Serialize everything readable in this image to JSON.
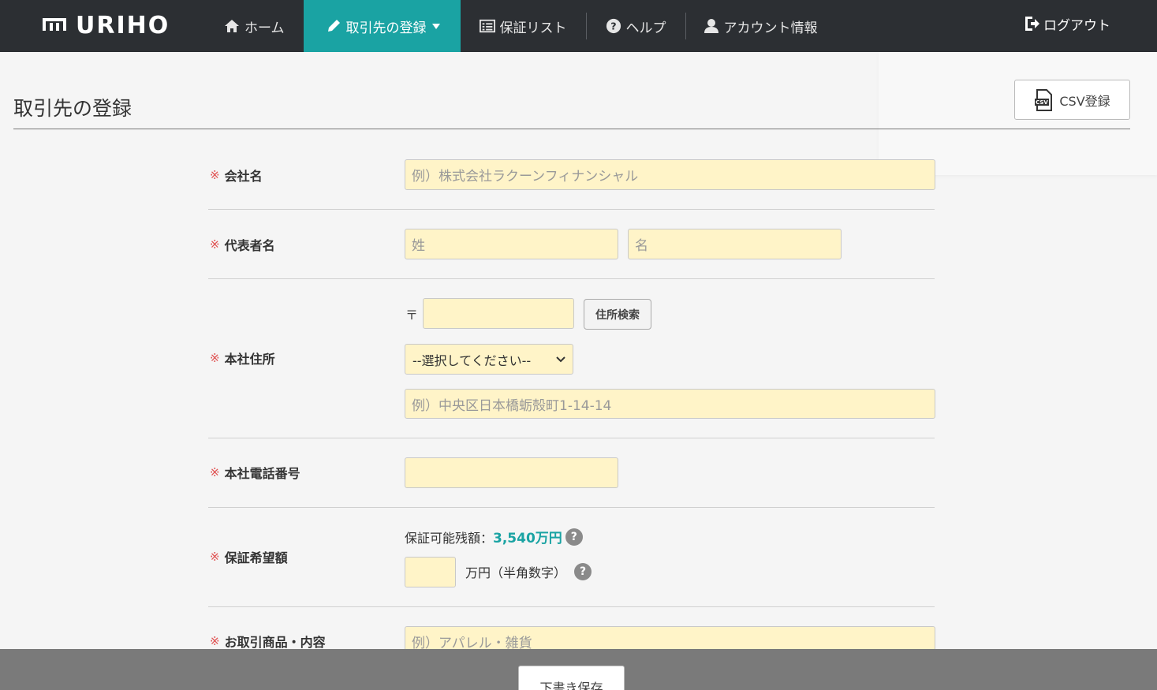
{
  "header": {
    "logo": "URIHO",
    "nav": [
      {
        "label": "ホーム"
      },
      {
        "label": "取引先の登録"
      },
      {
        "label": "保証リスト"
      },
      {
        "label": "ヘルプ"
      },
      {
        "label": "アカウント情報"
      }
    ],
    "logout": "ログアウト"
  },
  "page": {
    "title": "取引先の登録",
    "csv_button": "CSV登録"
  },
  "form": {
    "required_mark": "※",
    "company": {
      "label": "会社名",
      "placeholder": "例）株式会社ラクーンフィナンシャル"
    },
    "representative": {
      "label": "代表者名",
      "last_placeholder": "姓",
      "first_placeholder": "名"
    },
    "address": {
      "label": "本社住所",
      "postal_mark": "〒",
      "search_button": "住所検索",
      "prefecture_selected": "--選択してください--",
      "street_placeholder": "例）中央区日本橋蛎殻町1-14-14"
    },
    "phone": {
      "label": "本社電話番号"
    },
    "amount": {
      "label": "保証希望額",
      "available_label": "保証可能残額：",
      "available_value": "3,540万円",
      "help": "?",
      "unit": "万円（半角数字）"
    },
    "products": {
      "label": "お取引商品・内容",
      "placeholder": "例）アパレル・雑貨"
    }
  },
  "footer": {
    "draft_button": "下書き保存"
  }
}
